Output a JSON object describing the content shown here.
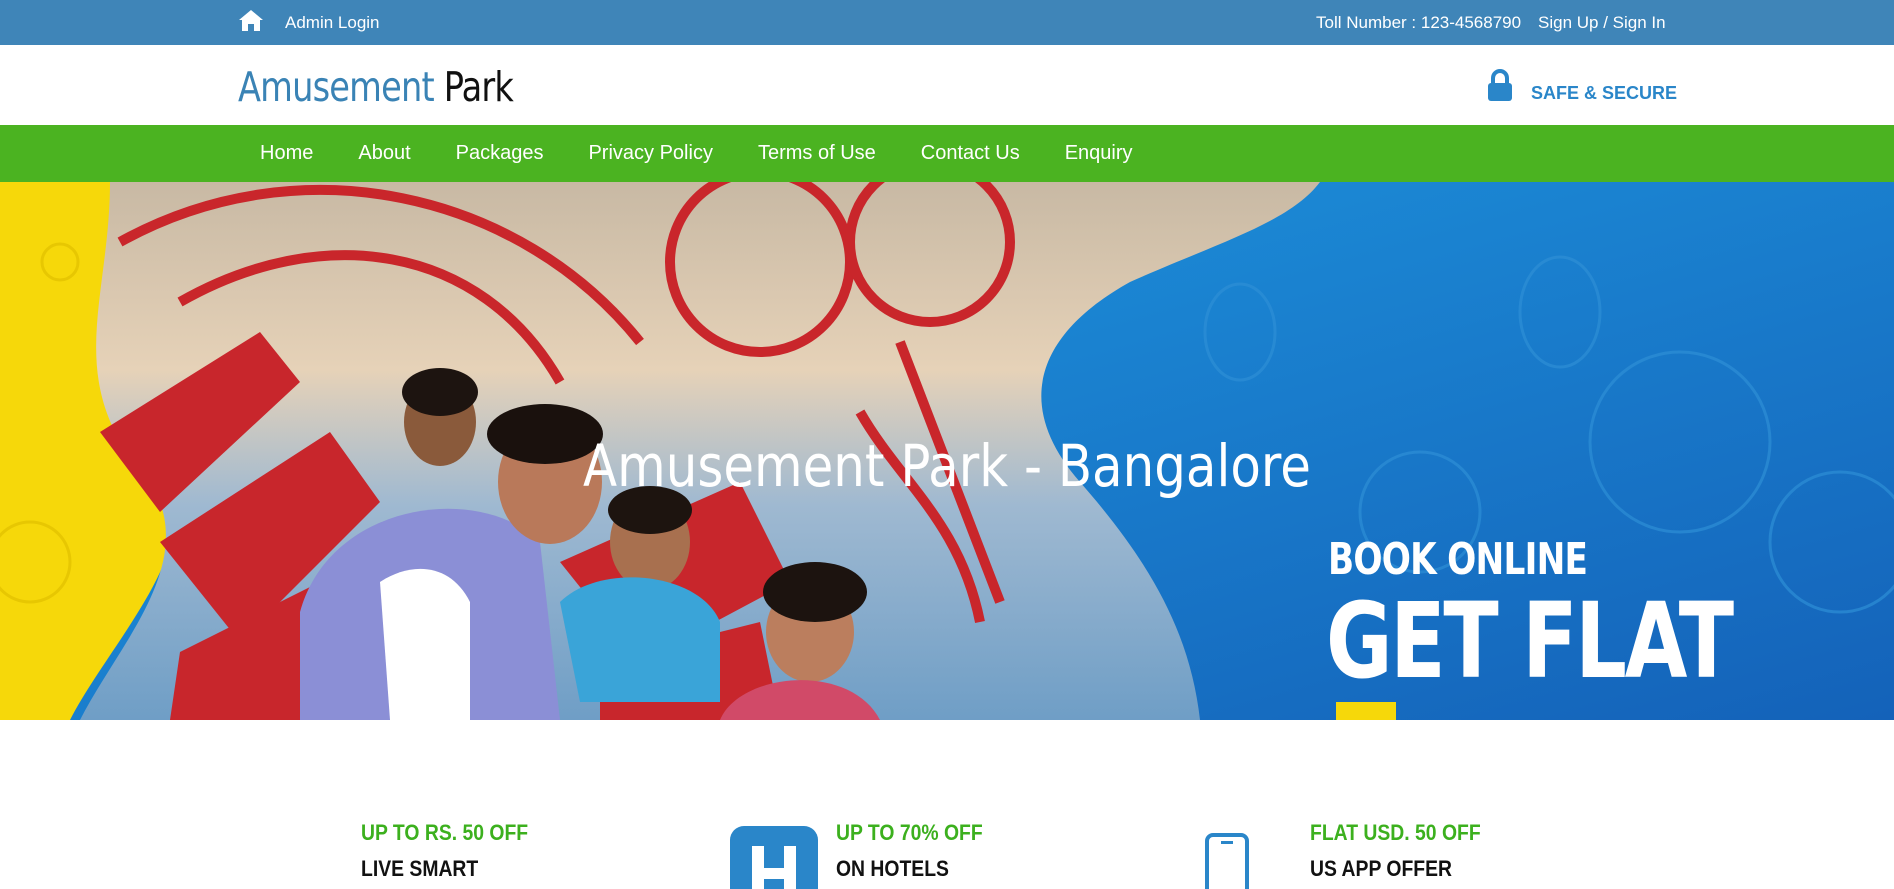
{
  "topbar": {
    "admin_login": "Admin Login",
    "toll_number": "Toll Number : 123-4568790",
    "sign_link": "Sign Up / Sign In",
    "home_icon": "home-icon",
    "bg_color": "#3f85b8"
  },
  "header": {
    "logo_part1": "Amusement",
    "logo_part2": "Park",
    "secure_text": "SAFE & SECURE",
    "lock_icon": "lock-icon"
  },
  "nav": {
    "bg_color": "#4bb321",
    "items": [
      "Home",
      "About",
      "Packages",
      "Privacy Policy",
      "Terms of Use",
      "Contact Us",
      "Enquiry"
    ]
  },
  "hero": {
    "title": "Amusement Park - Bangalore",
    "promo_line1": "BOOK ONLINE",
    "promo_line2": "GET FLAT"
  },
  "offers": [
    {
      "line1": "UP TO RS. 50 OFF",
      "line2": "LIVE SMART",
      "icon": "none"
    },
    {
      "line1": "UP TO 70% OFF",
      "line2": "ON HOTELS",
      "icon": "hotel-icon"
    },
    {
      "line1": "FLAT USD. 50 OFF",
      "line2": "US APP OFFER",
      "icon": "mobile-icon"
    }
  ],
  "colors": {
    "accent_blue": "#2a86c9",
    "accent_green": "#3cb01e",
    "hero_yellow": "#f6d80a",
    "hero_blue": "#1b86d5"
  }
}
